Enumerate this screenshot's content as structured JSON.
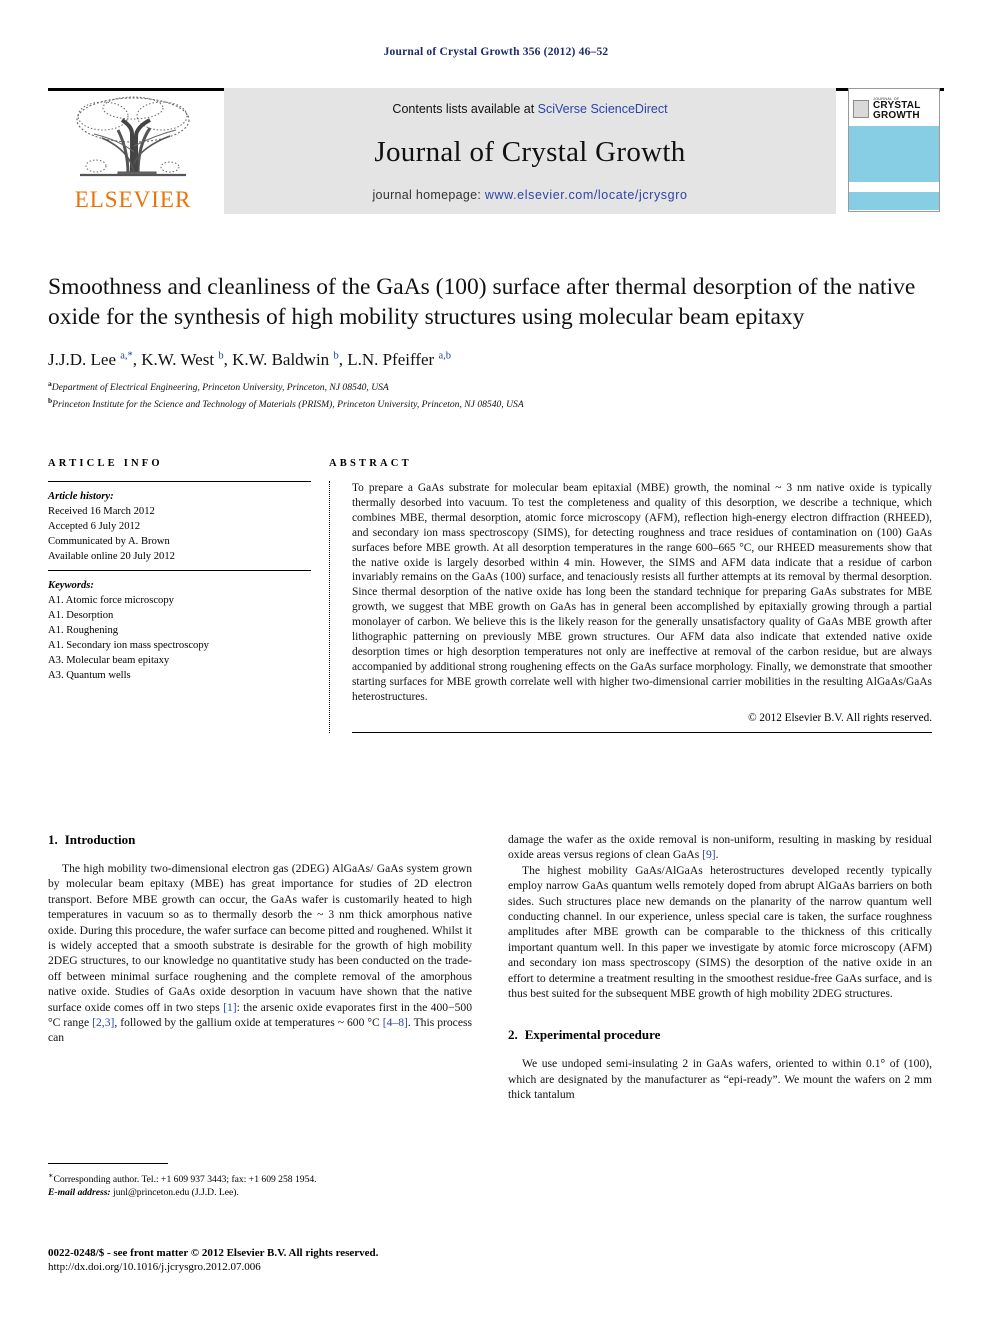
{
  "running_head": "Journal of Crystal Growth 356 (2012) 46–52",
  "masthead": {
    "publisher_name": "ELSEVIER",
    "contents_prefix": "Contents lists available at",
    "sciverse_link": "SciVerse ScienceDirect",
    "journal_title": "Journal of Crystal Growth",
    "homepage_prefix": "journal homepage:",
    "homepage_url": "www.elsevier.com/locate/jcrysgro",
    "cover": {
      "journal_of": "JOURNAL OF",
      "line1": "CRYSTAL",
      "line2": "GROWTH"
    }
  },
  "article": {
    "title": "Smoothness and cleanliness of the GaAs (100) surface after thermal desorption of the native oxide for the synthesis of high mobility structures using molecular beam epitaxy",
    "authors_html": "J.J.D. Lee <sup>a,*</sup>, K.W. West <sup>b</sup>, K.W. Baldwin <sup>b</sup>, L.N. Pfeiffer <sup>a,b</sup>",
    "affiliations": [
      {
        "marker": "a",
        "text": "Department of Electrical Engineering, Princeton University, Princeton, NJ 08540, USA"
      },
      {
        "marker": "b",
        "text": "Princeton Institute for the Science and Technology of Materials (PRISM), Princeton University, Princeton, NJ 08540, USA"
      }
    ]
  },
  "info": {
    "heading": "ARTICLE INFO",
    "history_label": "Article history:",
    "history": [
      "Received 16 March 2012",
      "Accepted 6 July 2012",
      "Communicated by A. Brown",
      "Available online 20 July 2012"
    ],
    "keywords_label": "Keywords:",
    "keywords": [
      "A1. Atomic force microscopy",
      "A1. Desorption",
      "A1. Roughening",
      "A1. Secondary ion mass spectroscopy",
      "A3. Molecular beam epitaxy",
      "A3. Quantum wells"
    ]
  },
  "abstract": {
    "heading": "ABSTRACT",
    "text": "To prepare a GaAs substrate for molecular beam epitaxial (MBE) growth, the nominal ~ 3 nm native oxide is typically thermally desorbed into vacuum. To test the completeness and quality of this desorption, we describe a technique, which combines MBE, thermal desorption, atomic force microscopy (AFM), reflection high-energy electron diffraction (RHEED), and secondary ion mass spectroscopy (SIMS), for detecting roughness and trace residues of contamination on (100) GaAs surfaces before MBE growth. At all desorption temperatures in the range 600–665 °C, our RHEED measurements show that the native oxide is largely desorbed within 4 min. However, the SIMS and AFM data indicate that a residue of carbon invariably remains on the GaAs (100) surface, and tenaciously resists all further attempts at its removal by thermal desorption. Since thermal desorption of the native oxide has long been the standard technique for preparing GaAs substrates for MBE growth, we suggest that MBE growth on GaAs has in general been accomplished by epitaxially growing through a partial monolayer of carbon. We believe this is the likely reason for the generally unsatisfactory quality of GaAs MBE growth after lithographic patterning on previously MBE grown structures. Our AFM data also indicate that extended native oxide desorption times or high desorption temperatures not only are ineffective at removal of the carbon residue, but are always accompanied by additional strong roughening effects on the GaAs surface morphology. Finally, we demonstrate that smoother starting surfaces for MBE growth correlate well with higher two-dimensional carrier mobilities in the resulting AlGaAs/GaAs heterostructures.",
    "copyright": "© 2012 Elsevier B.V. All rights reserved."
  },
  "sections": {
    "introduction": {
      "number": "1.",
      "title": "Introduction",
      "para1_a": "The high mobility two-dimensional electron gas (2DEG) AlGaAs/ GaAs system grown by molecular beam epitaxy (MBE) has great importance for studies of 2D electron transport. Before MBE growth can occur, the GaAs wafer is customarily heated to high temperatures in vacuum so as to thermally desorb the ~ 3 nm thick amorphous native oxide. During this procedure, the wafer surface can become pitted and roughened. Whilst it is widely accepted that a smooth substrate is desirable for the growth of high mobility 2DEG structures, to our knowledge no quantitative study has been conducted on the trade-off between minimal surface roughening and the complete removal of the amorphous native oxide. Studies of GaAs oxide desorption in vacuum have shown that the native surface oxide comes off in two steps ",
      "ref1": "[1]",
      "para1_b": ": the arsenic oxide evaporates first in the 400−500 °C range ",
      "ref2": "[2,3]",
      "para1_c": ", followed by the gallium oxide at temperatures ~ 600 °C ",
      "ref3": "[4–8]",
      "para1_d": ". This process can ",
      "para1_cont_a": "damage the wafer as the oxide removal is non-uniform, resulting in masking by residual oxide areas versus regions of clean GaAs ",
      "ref4": "[9]",
      "para1_cont_b": ".",
      "para2": "The highest mobility GaAs/AlGaAs heterostructures developed recently typically employ narrow GaAs quantum wells remotely doped from abrupt AlGaAs barriers on both sides. Such structures place new demands on the planarity of the narrow quantum well conducting channel. In our experience, unless special care is taken, the surface roughness amplitudes after MBE growth can be comparable to the thickness of this critically important quantum well. In this paper we investigate by atomic force microscopy (AFM) and secondary ion mass spectroscopy (SIMS) the desorption of the native oxide in an effort to determine a treatment resulting in the smoothest residue-free GaAs surface, and is thus best suited for the subsequent MBE growth of high mobility 2DEG structures."
    },
    "experimental": {
      "number": "2.",
      "title": "Experimental procedure",
      "para1": "We use undoped semi-insulating 2 in GaAs wafers, oriented to within 0.1° of (100), which are designated by the manufacturer as “epi-ready”. We mount the wafers on 2 mm thick tantalum"
    }
  },
  "footnote": {
    "corresponding": "Corresponding author. Tel.: +1 609 937 3443; fax: +1 609 258 1954.",
    "email_label": "E-mail address:",
    "email": "junl@princeton.edu (J.J.D. Lee)."
  },
  "footer": {
    "issn_line": "0022-0248/$ - see front matter © 2012 Elsevier B.V. All rights reserved.",
    "doi_line": "http://dx.doi.org/10.1016/j.jcrysgro.2012.07.006"
  }
}
